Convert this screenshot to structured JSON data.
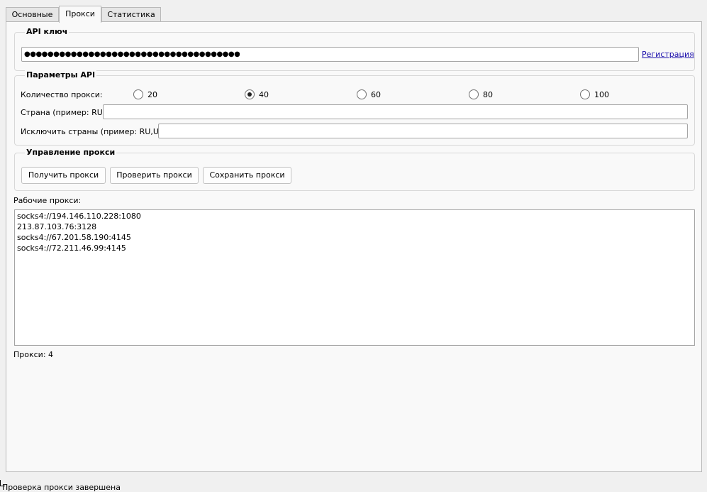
{
  "tabs": [
    {
      "label": "Основные",
      "active": false
    },
    {
      "label": "Прокси",
      "active": true
    },
    {
      "label": "Статистика",
      "active": false
    }
  ],
  "api_key": {
    "title": "API ключ",
    "masked_value": "●●●●●●●●●●●●●●●●●●●●●●●●●●●●●●●●●●●●●",
    "register_link": "Регистрация"
  },
  "api_params": {
    "title": "Параметры API",
    "count_label": "Количество прокси:",
    "count_options": [
      "20",
      "40",
      "60",
      "80",
      "100"
    ],
    "count_selected": "40",
    "country_label": "Страна (пример: RU):",
    "country_value": "",
    "exclude_label": "Исключить страны (пример: RU,UA):",
    "exclude_value": ""
  },
  "proxy_control": {
    "title": "Управление прокси",
    "get_label": "Получить прокси",
    "check_label": "Проверить прокси",
    "save_label": "Сохранить прокси"
  },
  "working": {
    "label": "Рабочие прокси:",
    "proxies": [
      "socks4://194.146.110.228:1080",
      "213.87.103.76:3128",
      "socks4://67.201.58.190:4145",
      "socks4://72.211.46.99:4145"
    ],
    "count_text": "Прокси: 4"
  },
  "status_bar": {
    "text": "Проверка прокси завершена"
  }
}
